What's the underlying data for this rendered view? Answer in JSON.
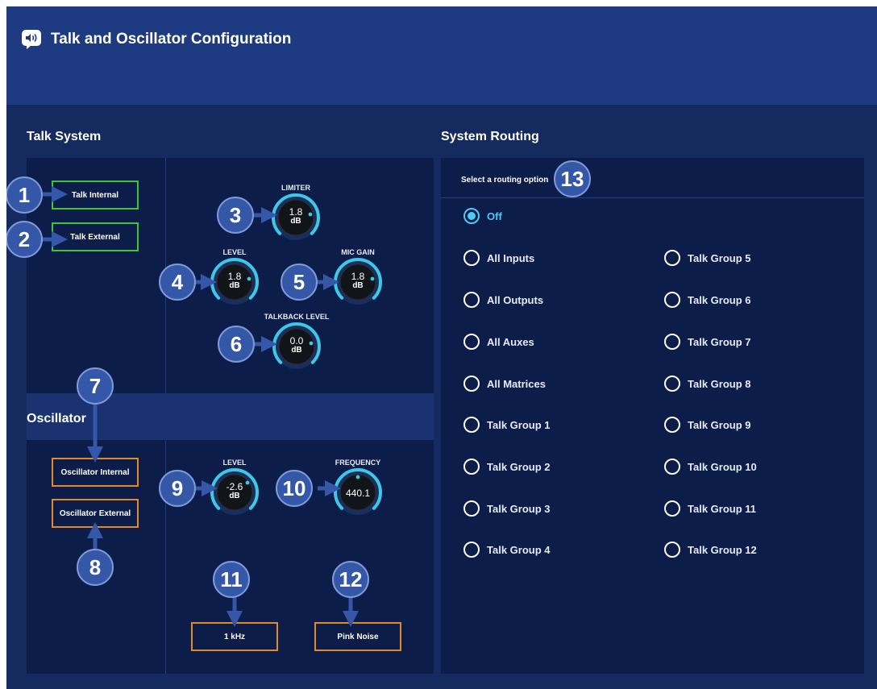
{
  "window": {
    "title": "Talk and Oscillator Configuration",
    "title_icon": "talk-speaker-icon"
  },
  "talk_system": {
    "title": "Talk System",
    "buttons": {
      "internal": "Talk Internal",
      "external": "Talk External"
    },
    "knobs": {
      "limiter": {
        "label": "LIMITER",
        "value": "1.8",
        "unit": "dB"
      },
      "level": {
        "label": "LEVEL",
        "value": "1.8",
        "unit": "dB"
      },
      "mic_gain": {
        "label": "MIC GAIN",
        "value": "1.8",
        "unit": "dB"
      },
      "talkback_level": {
        "label": "TALKBACK LEVEL",
        "value": "0.0",
        "unit": "dB"
      }
    }
  },
  "oscillator": {
    "title": "Oscillator",
    "buttons": {
      "internal": "Oscillator Internal",
      "external": "Oscillator External",
      "one_khz": "1 kHz",
      "pink_noise": "Pink Noise"
    },
    "knobs": {
      "level": {
        "label": "LEVEL",
        "value": "-2.6",
        "unit": "dB"
      },
      "frequency": {
        "label": "FREQUENCY",
        "value": "440.1"
      }
    }
  },
  "system_routing": {
    "title": "System Routing",
    "subtitle": "Select a routing option",
    "selected": "Off",
    "options_left": [
      "Off",
      "All Inputs",
      "All Outputs",
      "All Auxes",
      "All Matrices",
      "Talk Group 1",
      "Talk Group 2",
      "Talk Group 3",
      "Talk Group 4"
    ],
    "options_right": [
      "Talk Group 5",
      "Talk Group 6",
      "Talk Group 7",
      "Talk Group 8",
      "Talk Group 9",
      "Talk Group 10",
      "Talk Group 11",
      "Talk Group 12"
    ]
  },
  "callouts": [
    "1",
    "2",
    "3",
    "4",
    "5",
    "6",
    "7",
    "8",
    "9",
    "10",
    "11",
    "12",
    "13"
  ],
  "colors": {
    "background": "#152a5e",
    "header": "#1e3a80",
    "panel": "#0c1d4a",
    "talk_button_border": "#3ec43a",
    "oscillator_button_border": "#e08a2a",
    "knob_arc": "#3fc7e6",
    "selected_radio": "#4fc8f2",
    "callout": "#3557a8"
  }
}
